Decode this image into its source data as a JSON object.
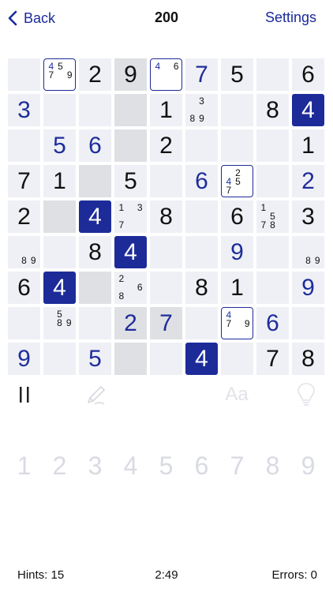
{
  "header": {
    "back_label": "Back",
    "title": "200",
    "settings_label": "Settings"
  },
  "colors": {
    "accent": "#1d2b99",
    "cell": "#eef0f5",
    "cell_shaded": "#dfe0e4",
    "given_text": "#111111",
    "user_text": "#1f2d9c",
    "numpad_disabled": "#d9dbe3"
  },
  "board": {
    "shaded": [
      "000100000",
      "000100000",
      "000100000",
      "001000000",
      "010000000",
      "000100000",
      "001000000",
      "000110000",
      "000100000"
    ],
    "cells": [
      [
        {
          "v": ""
        },
        {
          "n": [
            "4",
            "5",
            "",
            "7",
            "",
            "9"
          ],
          "hl": [
            "4"
          ],
          "boxed": true
        },
        {
          "v": "2",
          "t": "given"
        },
        {
          "v": "9",
          "t": "given"
        },
        {
          "n": [
            "4",
            "",
            "6"
          ],
          "hl": [
            "4"
          ],
          "boxed": true
        },
        {
          "v": "7",
          "t": "user"
        },
        {
          "v": "5",
          "t": "given"
        },
        {
          "v": ""
        },
        {
          "v": "6",
          "t": "given"
        }
      ],
      [
        {
          "v": "3",
          "t": "user"
        },
        {
          "v": ""
        },
        {
          "v": ""
        },
        {
          "v": ""
        },
        {
          "v": "1",
          "t": "given"
        },
        {
          "n": [
            "",
            "3",
            "",
            "",
            "",
            "",
            "8",
            "9",
            ""
          ]
        },
        {
          "v": ""
        },
        {
          "v": "8",
          "t": "given"
        },
        {
          "v": "4",
          "t": "given",
          "sel": true
        }
      ],
      [
        {
          "v": ""
        },
        {
          "v": "5",
          "t": "user"
        },
        {
          "v": "6",
          "t": "user"
        },
        {
          "v": ""
        },
        {
          "v": "2",
          "t": "given"
        },
        {
          "v": ""
        },
        {
          "v": ""
        },
        {
          "v": ""
        },
        {
          "v": "1",
          "t": "given"
        }
      ],
      [
        {
          "v": "7",
          "t": "given"
        },
        {
          "v": "1",
          "t": "given"
        },
        {
          "v": ""
        },
        {
          "v": "5",
          "t": "given"
        },
        {
          "v": ""
        },
        {
          "v": "6",
          "t": "user"
        },
        {
          "n": [
            "",
            "2",
            "",
            "4",
            "5",
            "",
            "7",
            "",
            ""
          ],
          "hl": [
            "4"
          ],
          "boxed": true
        },
        {
          "v": ""
        },
        {
          "v": "2",
          "t": "user"
        }
      ],
      [
        {
          "v": "2",
          "t": "given"
        },
        {
          "v": ""
        },
        {
          "v": "4",
          "t": "given",
          "sel": true
        },
        {
          "n": [
            "1",
            "",
            "3",
            "",
            "",
            "",
            "7",
            "",
            ""
          ]
        },
        {
          "v": "8",
          "t": "given"
        },
        {
          "v": ""
        },
        {
          "v": "6",
          "t": "given"
        },
        {
          "n": [
            "1",
            "",
            "",
            "",
            "5",
            "",
            "7",
            "8",
            ""
          ]
        },
        {
          "v": "3",
          "t": "given"
        }
      ],
      [
        {
          "n": [
            "",
            "",
            "",
            "",
            "",
            "",
            "",
            "8",
            "9"
          ]
        },
        {
          "v": ""
        },
        {
          "v": "8",
          "t": "given"
        },
        {
          "v": "4",
          "t": "given",
          "sel": true
        },
        {
          "v": ""
        },
        {
          "v": ""
        },
        {
          "v": "9",
          "t": "user"
        },
        {
          "v": ""
        },
        {
          "n": [
            "",
            "",
            "",
            "",
            "",
            "",
            "",
            "8",
            "9"
          ]
        }
      ],
      [
        {
          "v": "6",
          "t": "given"
        },
        {
          "v": "4",
          "t": "given",
          "sel": true
        },
        {
          "v": ""
        },
        {
          "n": [
            "2",
            "",
            "",
            "",
            "",
            "6",
            "8",
            "",
            ""
          ]
        },
        {
          "v": ""
        },
        {
          "v": "8",
          "t": "given"
        },
        {
          "v": "1",
          "t": "given"
        },
        {
          "v": ""
        },
        {
          "v": "9",
          "t": "user"
        }
      ],
      [
        {
          "v": ""
        },
        {
          "n": [
            "",
            "5",
            "",
            "",
            "8",
            "9",
            "",
            "",
            ""
          ]
        },
        {
          "v": ""
        },
        {
          "v": "2",
          "t": "user"
        },
        {
          "v": "7",
          "t": "user"
        },
        {
          "v": ""
        },
        {
          "n": [
            "4",
            "",
            "",
            "7",
            "",
            "9",
            "",
            "",
            ""
          ],
          "hl": [
            "4"
          ],
          "boxed": true
        },
        {
          "v": "6",
          "t": "user"
        },
        {
          "v": ""
        }
      ],
      [
        {
          "v": "9",
          "t": "user"
        },
        {
          "v": ""
        },
        {
          "v": "5",
          "t": "user"
        },
        {
          "v": ""
        },
        {
          "v": ""
        },
        {
          "v": "4",
          "t": "given",
          "sel": true
        },
        {
          "v": ""
        },
        {
          "v": "7",
          "t": "given"
        },
        {
          "v": "8",
          "t": "given"
        }
      ]
    ]
  },
  "tools": [
    {
      "name": "pause-icon"
    },
    {
      "name": "pencil-icon"
    },
    {
      "name": "font-size-icon",
      "label": "Aa"
    },
    {
      "name": "lightbulb-icon"
    }
  ],
  "numpad": [
    "1",
    "2",
    "3",
    "4",
    "5",
    "6",
    "7",
    "8",
    "9"
  ],
  "footer": {
    "hints": "Hints: 15",
    "timer": "2:49",
    "errors": "Errors: 0"
  }
}
